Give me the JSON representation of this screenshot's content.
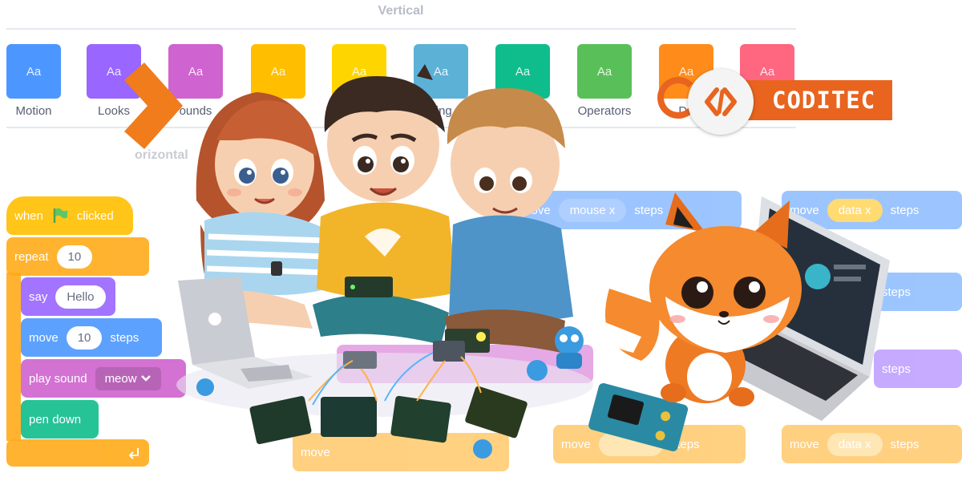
{
  "palette": {
    "title": "Vertical",
    "categories": [
      {
        "label": "Motion",
        "color": "#4c97ff",
        "glyph": "Aa"
      },
      {
        "label": "Looks",
        "color": "#9966ff",
        "glyph": "Aa"
      },
      {
        "label": "ounds",
        "color": "#cf63cf",
        "glyph": "Aa"
      },
      {
        "label": "",
        "color": "#ffbf00",
        "glyph": "Aa"
      },
      {
        "label": "",
        "color": "#ffd500",
        "glyph": "Aa"
      },
      {
        "label": "sing",
        "color": "#5cb1d6",
        "glyph": "Aa"
      },
      {
        "label": "",
        "color": "#0fbd8c",
        "glyph": "Aa"
      },
      {
        "label": "Operators",
        "color": "#59c059",
        "glyph": "Aa"
      },
      {
        "label": "Da",
        "color": "#ff8c1a",
        "glyph": "Aa"
      },
      {
        "label": "",
        "color": "#ff6680",
        "glyph": "Aa"
      }
    ],
    "horizontal_title": "orizontal"
  },
  "script": {
    "when_label": "when",
    "clicked_label": "clicked",
    "repeat_label": "repeat",
    "repeat_value": "10",
    "say_label": "say",
    "say_value": "Hello",
    "move_label": "move",
    "move_value": "10",
    "steps_label": "steps",
    "sound_label": "play sound",
    "sound_value": "meow",
    "pen_label": "pen down"
  },
  "bg_blocks": {
    "move": "move",
    "mouse": "mouse x",
    "data": "data x",
    "steps": "steps"
  },
  "logo": {
    "text": "CODITEC"
  },
  "colors": {
    "brand_orange": "#e8641f",
    "motion": "#4c97ff",
    "events": "#ffbf00"
  },
  "icons": [
    "green-flag-icon",
    "chevron-down-icon",
    "arrow-return-icon",
    "code-brackets-icon",
    "forward-chevron-icon",
    "fox-mascot",
    "laptop-icon",
    "microcontroller-board"
  ]
}
